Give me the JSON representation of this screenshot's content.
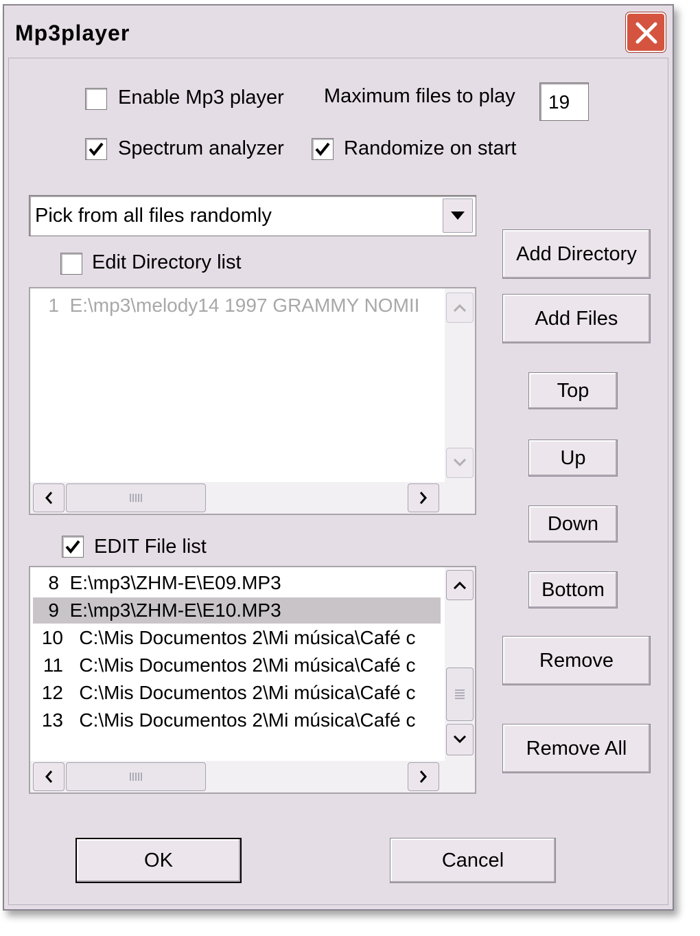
{
  "window": {
    "title": "Mp3player",
    "close_label": "close"
  },
  "options": {
    "enable_label": "Enable Mp3 player",
    "enable_checked": false,
    "max_files_label": "Maximum files to play",
    "max_files_value": "19",
    "spectrum_label": "Spectrum analyzer",
    "spectrum_checked": true,
    "randomize_label": "Randomize on start",
    "randomize_checked": true
  },
  "mode_select": {
    "value": "Pick from all files randomly"
  },
  "directory": {
    "edit_label": "Edit Directory list",
    "edit_checked": false,
    "items": [
      {
        "num": "1",
        "path": "E:\\mp3\\melody14 1997 GRAMMY NOMII"
      }
    ]
  },
  "files": {
    "edit_label": "EDIT File list",
    "edit_checked": true,
    "selected_index": 1,
    "items": [
      {
        "num": "8",
        "path": "E:\\mp3\\ZHM-E\\E09.MP3"
      },
      {
        "num": "9",
        "path": "E:\\mp3\\ZHM-E\\E10.MP3"
      },
      {
        "num": "10",
        "path": "C:\\Mis Documentos 2\\Mi música\\Café c"
      },
      {
        "num": "11",
        "path": "C:\\Mis Documentos 2\\Mi música\\Café c"
      },
      {
        "num": "12",
        "path": "C:\\Mis Documentos 2\\Mi música\\Café c"
      },
      {
        "num": "13",
        "path": "C:\\Mis Documentos 2\\Mi música\\Café c"
      }
    ]
  },
  "buttons": {
    "add_directory": "Add Directory",
    "add_files": "Add Files",
    "top": "Top",
    "up": "Up",
    "down": "Down",
    "bottom": "Bottom",
    "remove": "Remove",
    "remove_all": "Remove All",
    "ok": "OK",
    "cancel": "Cancel"
  },
  "colors": {
    "dialog_bg": "#e5dde5",
    "close_red": "#d5543f",
    "selected_row": "#c8c4c8",
    "disabled_text": "#a8a8a8"
  }
}
